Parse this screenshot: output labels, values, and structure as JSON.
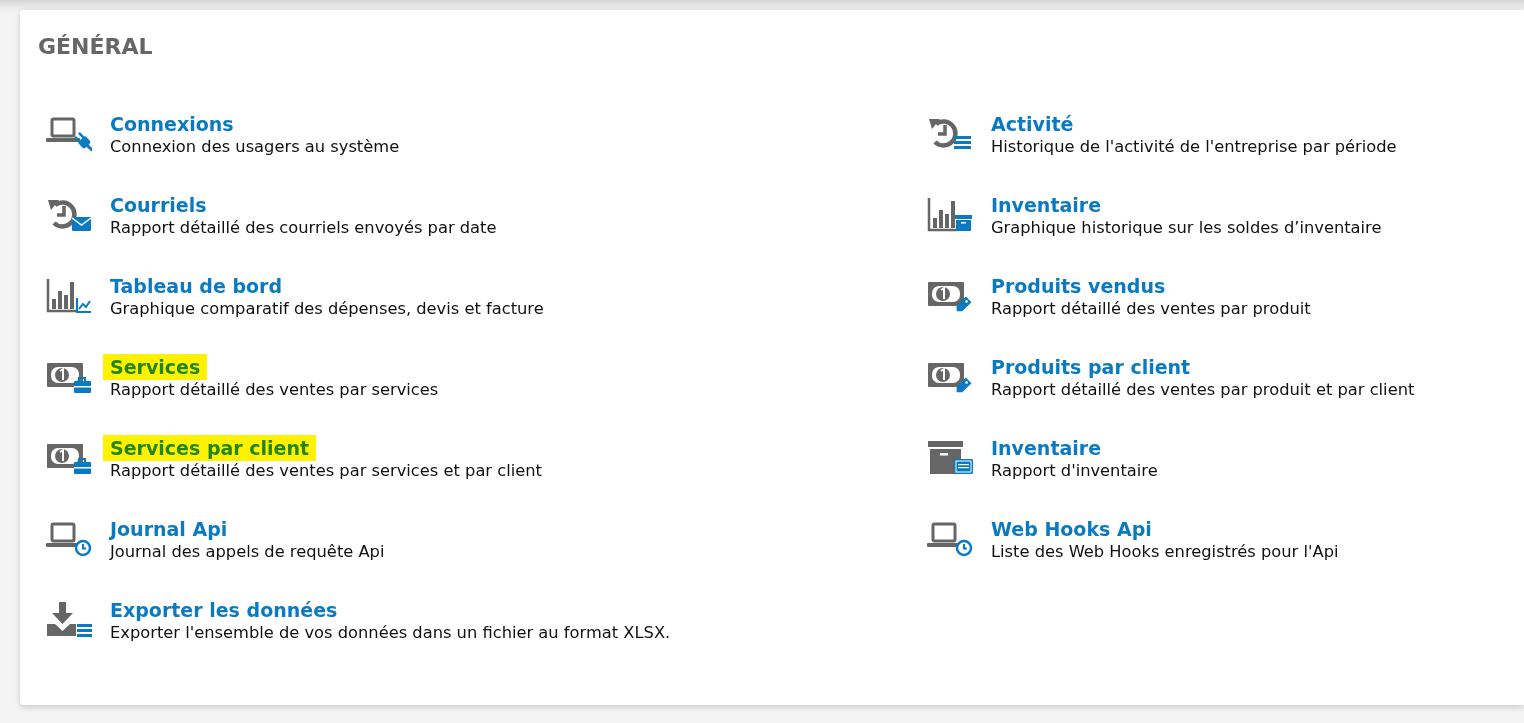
{
  "section": {
    "title": "GÉNÉRAL"
  },
  "columns": [
    {
      "items": [
        {
          "title": "Connexions",
          "description": "Connexion des usagers au système",
          "highlighted": false
        },
        {
          "title": "Courriels",
          "description": "Rapport détaillé des courriels envoyés par date",
          "highlighted": false
        },
        {
          "title": "Tableau de bord",
          "description": "Graphique comparatif des dépenses, devis et facture",
          "highlighted": false
        },
        {
          "title": "Services",
          "description": "Rapport détaillé des ventes par services",
          "highlighted": true
        },
        {
          "title": "Services par client",
          "description": "Rapport détaillé des ventes par services et par client",
          "highlighted": true
        },
        {
          "title": "Journal Api",
          "description": "Journal des appels de requête Api",
          "highlighted": false
        },
        {
          "title": "Exporter les données",
          "description": "Exporter l'ensemble de vos données dans un fichier au format XLSX.",
          "highlighted": false
        }
      ]
    },
    {
      "items": [
        {
          "title": "Activité",
          "description": "Historique de l'activité de l'entreprise par période",
          "highlighted": false
        },
        {
          "title": "Inventaire",
          "description": "Graphique historique sur les soldes d’inventaire",
          "highlighted": false
        },
        {
          "title": "Produits vendus",
          "description": "Rapport détaillé des ventes par produit",
          "highlighted": false
        },
        {
          "title": "Produits par client",
          "description": "Rapport détaillé des ventes par produit et par client",
          "highlighted": false
        },
        {
          "title": "Inventaire",
          "description": "Rapport d'inventaire",
          "highlighted": false
        },
        {
          "title": "Web Hooks Api",
          "description": "Liste des Web Hooks enregistrés pour l'Api",
          "highlighted": false
        }
      ]
    }
  ]
}
